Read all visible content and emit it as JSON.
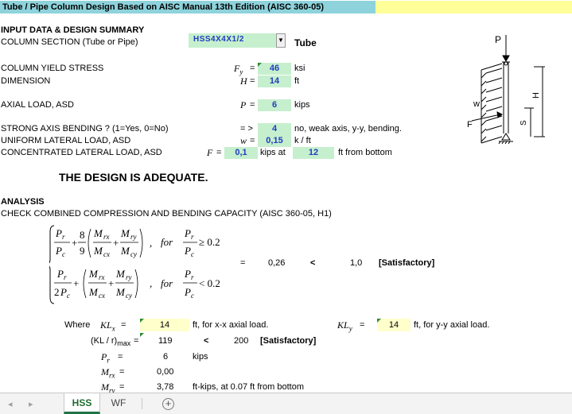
{
  "title": "Tube / Pipe Column Design Based on AISC Manual 13th Edition (AISC 360-05)",
  "inputs_header": "INPUT DATA & DESIGN SUMMARY",
  "column_section": {
    "label": "COLUMN SECTION (Tube or Pipe)",
    "value": "HSS4X4X1/2",
    "type": "Tube"
  },
  "yield_stress": {
    "label": "COLUMN YIELD STRESS",
    "symbol": "F",
    "sub": "y",
    "eq": "=",
    "value": "46",
    "unit": "ksi"
  },
  "dimension": {
    "label": "DIMENSION",
    "symbol": "H",
    "eq": "=",
    "value": "14",
    "unit": "ft"
  },
  "axial_load": {
    "label": "AXIAL LOAD, ASD",
    "symbol": "P",
    "eq": "=",
    "value": "6",
    "unit": "kips"
  },
  "strong_axis": {
    "label": "STRONG AXIS BENDING ? (1=Yes, 0=No)",
    "arrow": "= >",
    "value": "4",
    "note": "no, weak axis, y-y, bending."
  },
  "uniform_load": {
    "label": "UNIFORM LATERAL LOAD, ASD",
    "symbol": "w",
    "eq": "=",
    "value": "0,15",
    "unit": "k / ft"
  },
  "conc_load": {
    "label": "CONCENTRATED LATERAL LOAD, ASD",
    "symbol": "F",
    "eq": "=",
    "value": "0,1",
    "unit1": "kips at",
    "at_value": "12",
    "unit2": "ft from bottom"
  },
  "design_result": "THE DESIGN IS ADEQUATE.",
  "analysis_header": "ANALYSIS",
  "analysis_check": "CHECK COMBINED COMPRESSION AND BENDING CAPACITY (AISC 360-05, H1)",
  "interaction": {
    "eq": "=",
    "ratio": "0,26",
    "lt": "<",
    "limit": "1,0",
    "status": "[Satisfactory]"
  },
  "formula": {
    "for": "for",
    "cond1": "≥ 0.2",
    "cond2": "< 0.2",
    "n8": "8",
    "n9": "9",
    "two": "2"
  },
  "where": {
    "label": "Where",
    "klx_sym": "KL",
    "klx_sub": "x",
    "eq": "=",
    "klx_value": "14",
    "klx_note": "ft, for x-x axial load.",
    "kly_sym": "KL",
    "kly_sub": "y",
    "kly_value": "14",
    "kly_note": "ft, for y-y axial load."
  },
  "slenderness": {
    "label": "(KL / r)",
    "sub": "max",
    "eq": "=",
    "value": "119",
    "lt": "<",
    "limit": "200",
    "status": "[Satisfactory]"
  },
  "pr": {
    "sym": "P",
    "sub": "r",
    "eq": "=",
    "value": "6",
    "unit": "kips"
  },
  "mrx": {
    "sym": "M",
    "sub": "rx",
    "eq": "=",
    "value": "0,00"
  },
  "mry": {
    "sym": "M",
    "sub": "ry",
    "eq": "=",
    "value": "3,78",
    "unit": "ft-kips, at 0.07 ft from bottom"
  },
  "diagram": {
    "p": "P",
    "w": "w",
    "f": "F",
    "h": "H",
    "s": "S"
  },
  "tabs": {
    "nav_prev": "◂",
    "nav_next": "▸",
    "active": "HSS",
    "other": "WF",
    "add": "+"
  },
  "colors": {
    "accent_green": "#217346",
    "input_green": "#c6efce",
    "input_blue_text": "#1f3dbf",
    "title_cyan": "#8ed3dc"
  }
}
